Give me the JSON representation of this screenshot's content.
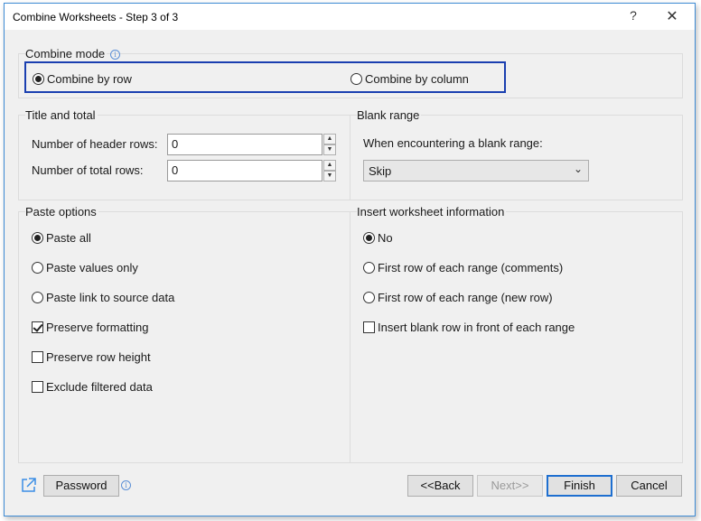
{
  "window": {
    "title": "Combine Worksheets - Step 3 of 3",
    "help_label": "?",
    "close_label": "✕"
  },
  "combine_mode": {
    "label": "Combine mode",
    "options": [
      {
        "label": "Combine by row",
        "selected": true
      },
      {
        "label": "Combine by column",
        "selected": false
      }
    ]
  },
  "title_total": {
    "label": "Title and total",
    "header_rows_label": "Number of header rows:",
    "header_rows_value": "0",
    "total_rows_label": "Number of total rows:",
    "total_rows_value": "0"
  },
  "blank_range": {
    "label": "Blank range",
    "prompt": "When encountering a blank range:",
    "selected": "Skip"
  },
  "paste_options": {
    "label": "Paste options",
    "radios": [
      {
        "label": "Paste all",
        "selected": true
      },
      {
        "label": "Paste values only",
        "selected": false
      },
      {
        "label": "Paste link to source data",
        "selected": false
      }
    ],
    "checks": [
      {
        "label": "Preserve formatting",
        "checked": true
      },
      {
        "label": "Preserve row height",
        "checked": false
      },
      {
        "label": "Exclude filtered data",
        "checked": false
      }
    ]
  },
  "insert_info": {
    "label": "Insert worksheet information",
    "radios": [
      {
        "label": "No",
        "selected": true
      },
      {
        "label": "First row of each range (comments)",
        "selected": false
      },
      {
        "label": "First row of each range (new row)",
        "selected": false
      }
    ],
    "checks": [
      {
        "label": "Insert blank row in front of each range",
        "checked": false
      }
    ]
  },
  "footer": {
    "password": "Password",
    "back": "<<Back",
    "next": "Next>>",
    "finish": "Finish",
    "cancel": "Cancel"
  },
  "colors": {
    "highlight_border": "#1a3fb0",
    "window_border": "#3c8ad4",
    "info_icon": "#5b8fd6"
  }
}
